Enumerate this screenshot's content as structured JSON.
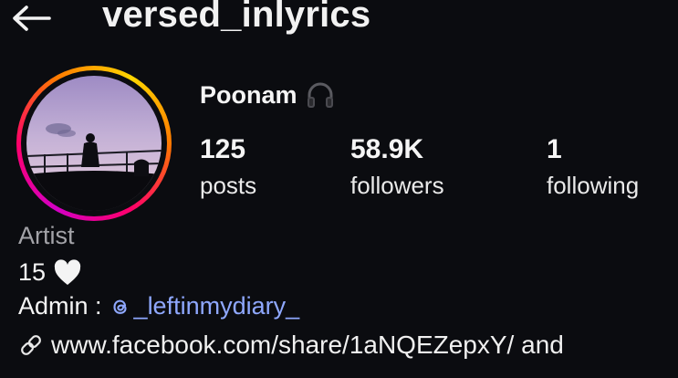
{
  "header": {
    "username": "versed_inlyrics",
    "back_icon": "arrow-left-icon"
  },
  "profile": {
    "display_name": "Poonam",
    "display_name_icon": "headphones-icon",
    "avatar_ring_colors": [
      "#d300c5",
      "#ff0069",
      "#ff7a00",
      "#ffd600"
    ]
  },
  "stats": [
    {
      "value": "125",
      "label": "posts"
    },
    {
      "value": "58.9K",
      "label": "followers"
    },
    {
      "value": "1",
      "label": "following"
    }
  ],
  "bio": {
    "category": "Artist",
    "line1": "15",
    "line1_icon": "white-heart-icon",
    "admin_prefix": "Admin :",
    "admin_mention": "_leftinmydiary_",
    "admin_mention_icon": "threads-icon",
    "link_icon": "link-icon",
    "link_text": "www.facebook.com/share/1aNQEZepxY/ and"
  },
  "colors": {
    "background": "#0b0c10",
    "text": "#f5f5f5",
    "category_text": "#a3a3a8",
    "mention_link": "#8fa8ff"
  }
}
